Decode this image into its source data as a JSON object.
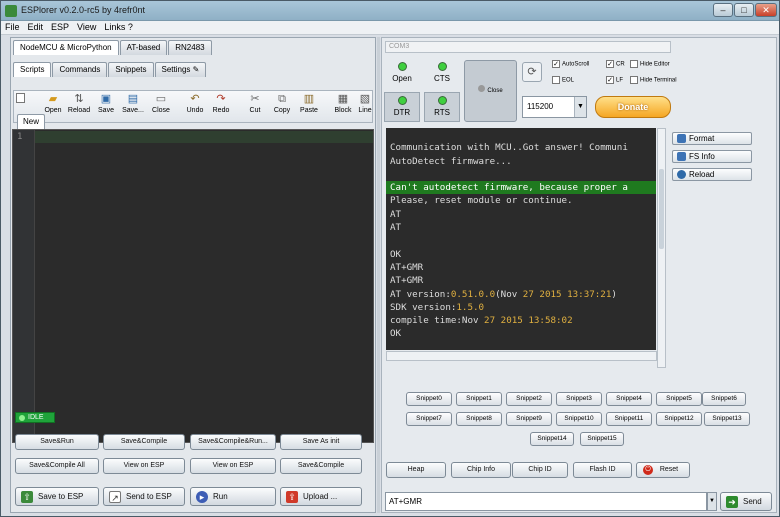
{
  "window": {
    "title": "ESPlorer v0.2.0-rc5 by 4refr0nt"
  },
  "menu": [
    "File",
    "Edit",
    "ESP",
    "View",
    "Links ?"
  ],
  "left": {
    "device_tabs": [
      "NodeMCU & MicroPython",
      "AT-based",
      "RN2483"
    ],
    "sub_tabs": [
      "Scripts",
      "Commands",
      "Snippets",
      "Settings"
    ],
    "toolbar": [
      "Open",
      "Reload",
      "Save",
      "Save...",
      "Close",
      "Undo",
      "Redo",
      "Cut",
      "Copy",
      "Paste",
      "Block",
      "Line"
    ],
    "file_tab": "New",
    "line_number": "1",
    "status": "IDLE",
    "buttons_row1": [
      "Save&Run",
      "Save&Compile",
      "Save&Compile&Run...",
      "Save As init"
    ],
    "buttons_row2": [
      "Save&Compile All",
      "View on ESP",
      "View on ESP",
      "Save&Compile"
    ],
    "bottom_buttons": [
      "Save to ESP",
      "Send to ESP",
      "Run",
      "Upload ..."
    ]
  },
  "right": {
    "port": "COM3",
    "open_label": "Open",
    "cts_label": "CTS",
    "dtr_label": "DTR",
    "rts_label": "RTS",
    "close_label": "Close",
    "checkboxes": {
      "autoscroll": "AutoScroll",
      "eol": "EOL",
      "cr": "CR",
      "lf": "LF",
      "hide_editor": "Hide Editor",
      "hide_terminal": "Hide Terminal"
    },
    "baud": "115200",
    "donate": "Donate",
    "side_buttons": [
      "Format",
      "FS Info",
      "Reload"
    ],
    "terminal_lines": [
      {
        "t": ""
      },
      {
        "t": "Communication with MCU..Got answer! Communi"
      },
      {
        "t": "AutoDetect firmware..."
      },
      {
        "t": ""
      },
      {
        "t": "Can't autodetect firmware, because proper a",
        "hl": true
      },
      {
        "t": "Please, reset module or continue."
      },
      {
        "t": "AT"
      },
      {
        "t": "AT"
      },
      {
        "t": ""
      },
      {
        "t": "OK"
      },
      {
        "t": "AT+GMR"
      },
      {
        "t": "AT+GMR"
      },
      {
        "t": "AT version:0.51.0.0(Nov 27 2015 13:37:21)"
      },
      {
        "t": "SDK version:1.5.0"
      },
      {
        "t": "compile time:Nov 27 2015 13:58:02"
      },
      {
        "t": "OK"
      }
    ],
    "snippets": [
      "Snippet0",
      "Snippet1",
      "Snippet2",
      "Snippet3",
      "Snippet4",
      "Snippet5",
      "Snippet6",
      "Snippet7",
      "Snippet8",
      "Snippet9",
      "Snippet10",
      "Snippet11",
      "Snippet12",
      "Snippet13",
      "Snippet14",
      "Snippet15"
    ],
    "bottom_buttons": [
      "Heap",
      "Chip Info",
      "Chip ID",
      "Flash ID",
      "Reset"
    ],
    "command_value": "AT+GMR",
    "send_label": "Send"
  },
  "colors": {
    "terminal_bg": "#2b2b2b",
    "highlight": "#1f7a1f",
    "number": "#e0b040",
    "idle": "#1fa33a",
    "donate": "#f5a623"
  }
}
